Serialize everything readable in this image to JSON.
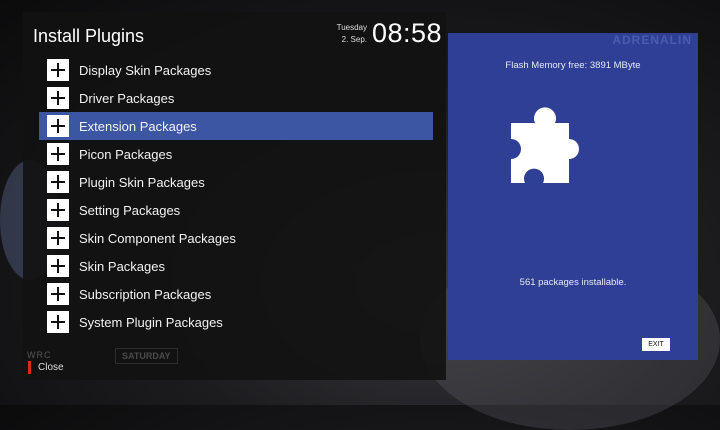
{
  "header": {
    "title": "Install Plugins",
    "day": "Tuesday",
    "date": "2. Sep.",
    "time": "08:58"
  },
  "plugin_list": [
    {
      "label": "Display Skin Packages",
      "selected": false
    },
    {
      "label": "Driver Packages",
      "selected": false
    },
    {
      "label": "Extension Packages",
      "selected": true
    },
    {
      "label": "Picon Packages",
      "selected": false
    },
    {
      "label": "Plugin Skin Packages",
      "selected": false
    },
    {
      "label": "Setting Packages",
      "selected": false
    },
    {
      "label": "Skin Component Packages",
      "selected": false
    },
    {
      "label": "Skin Packages",
      "selected": false
    },
    {
      "label": "Subscription Packages",
      "selected": false
    },
    {
      "label": "System Plugin Packages",
      "selected": false
    }
  ],
  "footer": {
    "close_label": "Close",
    "channel_logo": "WRC",
    "channel_tag": "SATURDAY"
  },
  "info_panel": {
    "brand": "ADRENALIN",
    "memory": "Flash Memory free: 3891 MByte",
    "icon": "puzzle-piece-icon",
    "count": "561 packages installable.",
    "exit_label": "EXIT"
  },
  "colors": {
    "selection": "#3c56a3",
    "info_panel": "#2e3f95",
    "close_key": "#e0261c"
  }
}
